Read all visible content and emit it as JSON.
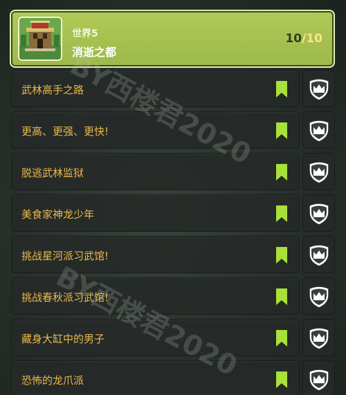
{
  "header": {
    "world_label": "世界5",
    "world_name": "消逝之都",
    "progress_current": "10",
    "progress_separator": "/",
    "progress_total": "10",
    "thumbnail_icon": "temple-thumbnail"
  },
  "levels": [
    {
      "title": "武林高手之路",
      "bookmark_icon": "bookmark-icon",
      "badge_icon": "crown-shield-icon"
    },
    {
      "title": "更高、更强、更快!",
      "bookmark_icon": "bookmark-icon",
      "badge_icon": "crown-shield-icon"
    },
    {
      "title": "脱逃武林监狱",
      "bookmark_icon": "bookmark-icon",
      "badge_icon": "crown-shield-icon"
    },
    {
      "title": "美食家神龙少年",
      "bookmark_icon": "bookmark-icon",
      "badge_icon": "crown-shield-icon"
    },
    {
      "title": "挑战星河派习武馆!",
      "bookmark_icon": "bookmark-icon",
      "badge_icon": "crown-shield-icon"
    },
    {
      "title": "挑战春秋派习武馆!",
      "bookmark_icon": "bookmark-icon",
      "badge_icon": "crown-shield-icon"
    },
    {
      "title": "藏身大缸中的男子",
      "bookmark_icon": "bookmark-icon",
      "badge_icon": "crown-shield-icon"
    },
    {
      "title": "恐怖的龙爪派",
      "bookmark_icon": "bookmark-icon",
      "badge_icon": "crown-shield-icon"
    }
  ],
  "watermarks": [
    "BY西楼君2020",
    "BY西楼君2020"
  ],
  "colors": {
    "header_green": "#a6c04f",
    "row_title": "#e9b94d",
    "bookmark_green": "#a9e03a",
    "progress_gold": "#ffe48a"
  }
}
